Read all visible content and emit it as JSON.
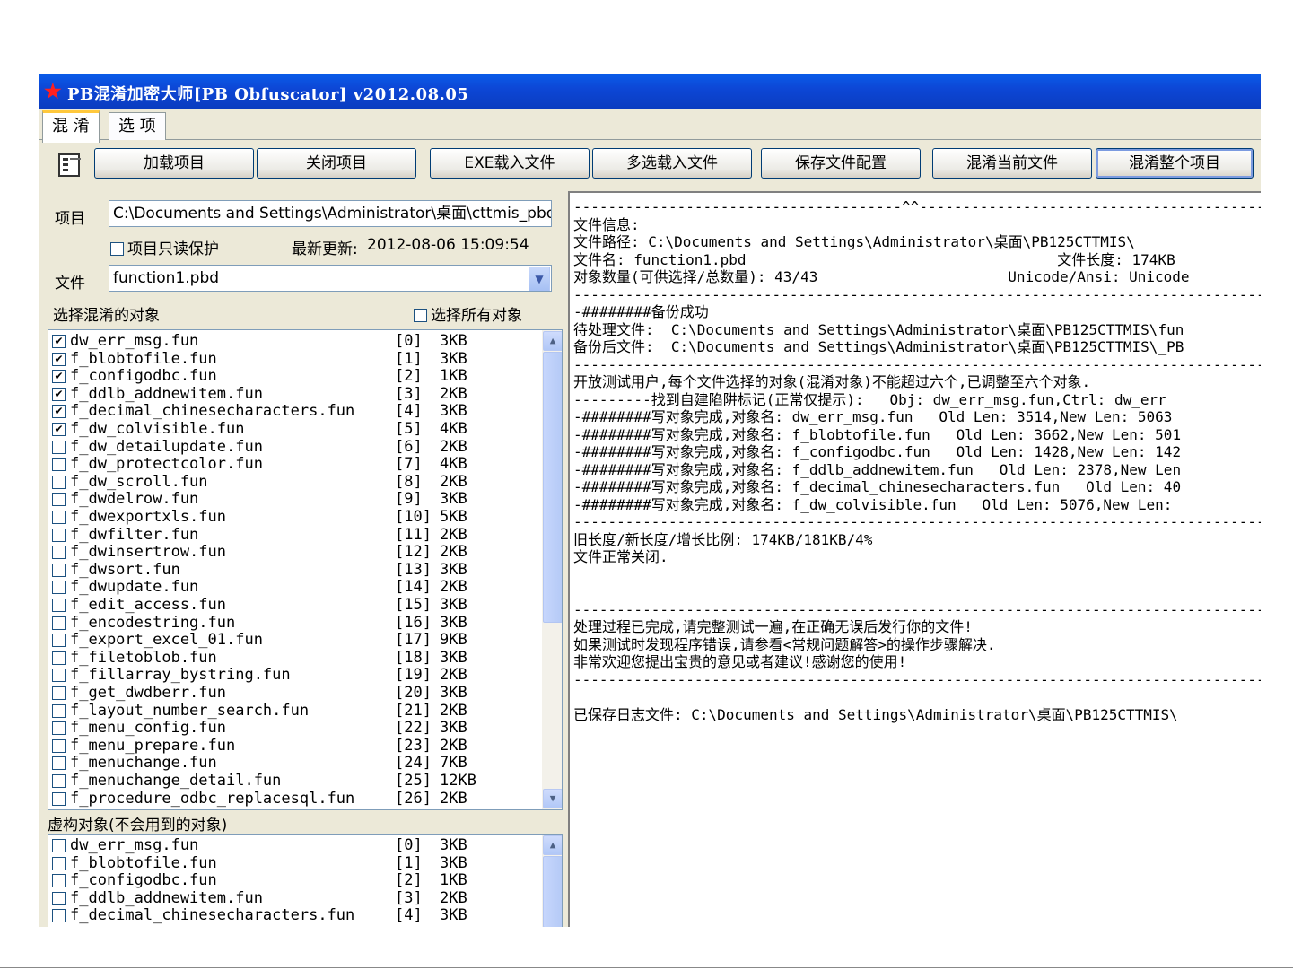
{
  "window": {
    "title": "PB混淆加密大师[PB Obfuscator] v2012.08.05"
  },
  "tabs": [
    {
      "label": "混 淆",
      "active": true
    },
    {
      "label": "选 项",
      "active": false
    }
  ],
  "toolbar": {
    "icon": "properties-icon",
    "buttons": [
      "加载项目",
      "关闭项目",
      "EXE载入文件",
      "多选载入文件",
      "保存文件配置",
      "混淆当前文件",
      "混淆整个项目"
    ]
  },
  "left": {
    "project_label": "项目",
    "project_value": "C:\\Documents and Settings\\Administrator\\桌面\\cttmis_pbo",
    "readonly_label": "项目只读保护",
    "last_update_label": "最新更新:",
    "last_update_value": "2012-08-06 15:09:54",
    "file_label": "文件",
    "file_value": "function1.pbd",
    "select_label": "选择混淆的对象",
    "select_all_label": "选择所有对象",
    "virtual_label": "虚构对象(不会用到的对象)"
  },
  "objects": [
    {
      "name": "dw_err_msg.fun",
      "idx": "[0]",
      "size": "3KB",
      "checked": true
    },
    {
      "name": "f_blobtofile.fun",
      "idx": "[1]",
      "size": "3KB",
      "checked": true
    },
    {
      "name": "f_configodbc.fun",
      "idx": "[2]",
      "size": "1KB",
      "checked": true
    },
    {
      "name": "f_ddlb_addnewitem.fun",
      "idx": "[3]",
      "size": "2KB",
      "checked": true
    },
    {
      "name": "f_decimal_chinesecharacters.fun",
      "idx": "[4]",
      "size": "3KB",
      "checked": true
    },
    {
      "name": "f_dw_colvisible.fun",
      "idx": "[5]",
      "size": "4KB",
      "checked": true
    },
    {
      "name": "f_dw_detailupdate.fun",
      "idx": "[6]",
      "size": "2KB",
      "checked": false
    },
    {
      "name": "f_dw_protectcolor.fun",
      "idx": "[7]",
      "size": "4KB",
      "checked": false
    },
    {
      "name": "f_dw_scroll.fun",
      "idx": "[8]",
      "size": "2KB",
      "checked": false
    },
    {
      "name": "f_dwdelrow.fun",
      "idx": "[9]",
      "size": "3KB",
      "checked": false
    },
    {
      "name": "f_dwexportxls.fun",
      "idx": "[10]",
      "size": "5KB",
      "checked": false
    },
    {
      "name": "f_dwfilter.fun",
      "idx": "[11]",
      "size": "2KB",
      "checked": false
    },
    {
      "name": "f_dwinsertrow.fun",
      "idx": "[12]",
      "size": "2KB",
      "checked": false
    },
    {
      "name": "f_dwsort.fun",
      "idx": "[13]",
      "size": "3KB",
      "checked": false
    },
    {
      "name": "f_dwupdate.fun",
      "idx": "[14]",
      "size": "2KB",
      "checked": false
    },
    {
      "name": "f_edit_access.fun",
      "idx": "[15]",
      "size": "3KB",
      "checked": false
    },
    {
      "name": "f_encodestring.fun",
      "idx": "[16]",
      "size": "3KB",
      "checked": false
    },
    {
      "name": "f_export_excel_01.fun",
      "idx": "[17]",
      "size": "9KB",
      "checked": false
    },
    {
      "name": "f_filetoblob.fun",
      "idx": "[18]",
      "size": "3KB",
      "checked": false
    },
    {
      "name": "f_fillarray_bystring.fun",
      "idx": "[19]",
      "size": "2KB",
      "checked": false
    },
    {
      "name": "f_get_dwdberr.fun",
      "idx": "[20]",
      "size": "3KB",
      "checked": false
    },
    {
      "name": "f_layout_number_search.fun",
      "idx": "[21]",
      "size": "2KB",
      "checked": false
    },
    {
      "name": "f_menu_config.fun",
      "idx": "[22]",
      "size": "3KB",
      "checked": false
    },
    {
      "name": "f_menu_prepare.fun",
      "idx": "[23]",
      "size": "2KB",
      "checked": false
    },
    {
      "name": "f_menuchange.fun",
      "idx": "[24]",
      "size": "7KB",
      "checked": false
    },
    {
      "name": "f_menuchange_detail.fun",
      "idx": "[25]",
      "size": "12KB",
      "checked": false
    },
    {
      "name": "f_procedure_odbc_replacesql.fun",
      "idx": "[26]",
      "size": "2KB",
      "checked": false
    }
  ],
  "virtual_objects": [
    {
      "name": "dw_err_msg.fun",
      "idx": "[0]",
      "size": "3KB",
      "checked": false
    },
    {
      "name": "f_blobtofile.fun",
      "idx": "[1]",
      "size": "3KB",
      "checked": false
    },
    {
      "name": "f_configodbc.fun",
      "idx": "[2]",
      "size": "1KB",
      "checked": false
    },
    {
      "name": "f_ddlb_addnewitem.fun",
      "idx": "[3]",
      "size": "2KB",
      "checked": false
    },
    {
      "name": "f_decimal_chinesecharacters.fun",
      "idx": "[4]",
      "size": "3KB",
      "checked": false
    }
  ],
  "log": [
    "--------------------------------------^^--------------------------------------------",
    "文件信息:",
    "文件路径: C:\\Documents and Settings\\Administrator\\桌面\\PB125CTTMIS\\",
    "文件名: function1.pbd                                    文件长度: 174KB",
    "对象数量(可供选择/总数量): 43/43                      Unicode/Ansi: Unicode",
    "-------------------------------------------------------------------------------------",
    "-########备份成功",
    "待处理文件:  C:\\Documents and Settings\\Administrator\\桌面\\PB125CTTMIS\\fun",
    "备份后文件:  C:\\Documents and Settings\\Administrator\\桌面\\PB125CTTMIS\\_PB",
    "-------------------------------------------------------------------------------------",
    "开放测试用户,每个文件选择的对象(混淆对象)不能超过六个,已调整至六个对象.",
    "---------找到自建陷阱标记(正常仅提示):   Obj: dw_err_msg.fun,Ctrl: dw_err",
    "-########写对象完成,对象名: dw_err_msg.fun   Old Len: 3514,New Len: 5063",
    "-########写对象完成,对象名: f_blobtofile.fun   Old Len: 3662,New Len: 501",
    "-########写对象完成,对象名: f_configodbc.fun   Old Len: 1428,New Len: 142",
    "-########写对象完成,对象名: f_ddlb_addnewitem.fun   Old Len: 2378,New Len",
    "-########写对象完成,对象名: f_decimal_chinesecharacters.fun   Old Len: 40",
    "-########写对象完成,对象名: f_dw_colvisible.fun   Old Len: 5076,New Len:",
    "-------------------------------------------------------------------------------------",
    "旧长度/新长度/增长比例: 174KB/181KB/4%",
    "文件正常关闭.",
    "",
    "",
    "-------------------------------------------------------------------------------------",
    "处理过程已完成,请完整测试一遍,在正确无误后发行你的文件!",
    "如果测试时发现程序错误,请参看<常规问题解答>的操作步骤解决.",
    "非常欢迎您提出宝贵的意见或者建议!感谢您的使用!",
    "-------------------------------------------------------------------------------------",
    "",
    "已保存日志文件: C:\\Documents and Settings\\Administrator\\桌面\\PB125CTTMIS\\"
  ]
}
